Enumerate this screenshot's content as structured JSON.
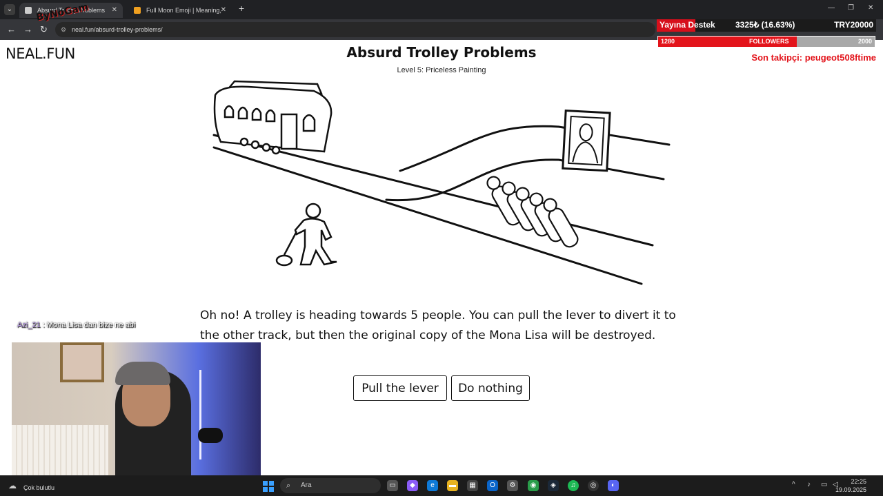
{
  "browser": {
    "tabs": [
      {
        "label": "Absurd Trolley Problems",
        "active": true
      },
      {
        "label": "Full Moon Emoji | Meaning,",
        "active": false
      }
    ],
    "url": "neal.fun/absurd-trolley-problems/"
  },
  "overlay": {
    "sticker": "ByNoGam",
    "donation_label": "Yayına Destek",
    "donation_amount": "3325₺ (16.63%)",
    "donation_goal": "TRY20000",
    "donation_progress": 0.1663,
    "followers_current": "1280",
    "followers_label": "FOLLOWERS",
    "followers_goal": "2000",
    "followers_progress": 0.64,
    "last_follower": "Son takipçi: peugeot508ftime",
    "colors": {
      "accent": "#e3141b"
    }
  },
  "page": {
    "logo": "NEAL.FUN",
    "title": "Absurd Trolley Problems",
    "level": "Level 5: Priceless Painting",
    "description": "Oh no! A trolley is heading towards 5 people. You can pull the lever to divert it to the other track, but then the original copy of the Mona Lisa will be destroyed. What do",
    "buttons": {
      "pull": "Pull the lever",
      "nothing": "Do nothing"
    }
  },
  "chat": {
    "user": "Azi_21",
    "message": ": Mona Lisa dan bize ne abi"
  },
  "taskbar": {
    "weather": "Çok bulutlu",
    "search_placeholder": "Ara",
    "time": "22:25",
    "date": "19.09.2025"
  }
}
